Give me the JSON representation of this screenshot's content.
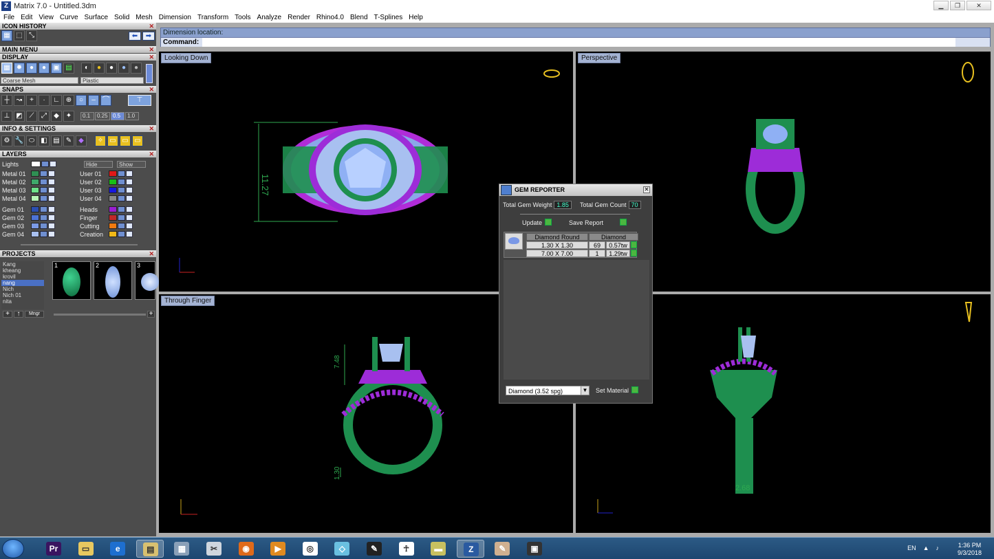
{
  "window": {
    "title": "Matrix 7.0 - Untitled.3dm",
    "app_icon": "Z"
  },
  "menu": [
    "File",
    "Edit",
    "View",
    "Curve",
    "Surface",
    "Solid",
    "Mesh",
    "Dimension",
    "Transform",
    "Tools",
    "Analyze",
    "Render",
    "Rhino4.0",
    "Blend",
    "T-Splines",
    "Help"
  ],
  "panels": {
    "icon_history": "ICON HISTORY",
    "main_menu": "MAIN MENU",
    "display": "DISPLAY",
    "display_mesh": "Coarse Mesh",
    "display_material": "Plastic",
    "snaps": "SNAPS",
    "snap_values": [
      "0.1",
      "0.25",
      "0.5",
      "1.0"
    ],
    "info": "INFO & SETTINGS",
    "layers": "LAYERS",
    "projects": "PROJECTS"
  },
  "layers": {
    "lights": "Lights",
    "hide": "Hide",
    "show": "Show",
    "left": [
      {
        "name": "Metal 01",
        "color": "#2f8f53"
      },
      {
        "name": "Metal 02",
        "color": "#3fa86a"
      },
      {
        "name": "Metal 03",
        "color": "#6ee28a"
      },
      {
        "name": "Metal 04",
        "color": "#b8f5b5"
      },
      {
        "name": "Gem 01",
        "color": "#2c4fb0"
      },
      {
        "name": "Gem 02",
        "color": "#4d73d6"
      },
      {
        "name": "Gem 03",
        "color": "#7b9ae6"
      },
      {
        "name": "Gem 04",
        "color": "#a8c0f0"
      }
    ],
    "right": [
      {
        "name": "User 01",
        "color": "#e01818"
      },
      {
        "name": "User 02",
        "color": "#18c018"
      },
      {
        "name": "User 03",
        "color": "#1818e0"
      },
      {
        "name": "User 04",
        "color": "#8a8a8a"
      },
      {
        "name": "Heads",
        "color": "#9a1ed0"
      },
      {
        "name": "Finger",
        "color": "#c02828"
      },
      {
        "name": "Cutting",
        "color": "#f07a10"
      },
      {
        "name": "Creation",
        "color": "#f0b818"
      }
    ]
  },
  "projects": {
    "items": [
      "Kang",
      "kheang",
      "krovil",
      "nang",
      "Nich",
      "Nich 01",
      "nita"
    ],
    "selected": "nang",
    "thumb_numbers": [
      "1",
      "2",
      "3"
    ],
    "manager_label": "Mngr"
  },
  "command": {
    "line1": "Dimension location:",
    "line2": "Command:"
  },
  "viewports": {
    "top_left": "Looking Down",
    "top_right": "Perspective",
    "bottom_left": "Through Finger",
    "dims": {
      "top_height": "11.27",
      "finger_top": "7.48",
      "finger_bottom": "1.30",
      "side_width": "2.68"
    }
  },
  "gem_reporter": {
    "title": "GEM REPORTER",
    "total_weight_label": "Total Gem Weight",
    "total_weight": "1.85",
    "total_count_label": "Total Gem Count",
    "total_count": "70",
    "update": "Update",
    "save_report": "Save Report",
    "col_shape": "Diamond Round",
    "col_material": "Diamond",
    "rows": [
      {
        "size": "1.30 X 1.30",
        "count": "69",
        "weight": "0.57tw"
      },
      {
        "size": "7.00 X 7.00",
        "count": "1",
        "weight": "1.29tw"
      }
    ],
    "material_select": "Diamond     (3.52 spg)",
    "set_material": "Set Material"
  },
  "taskbar": {
    "lang": "EN",
    "time": "1:36 PM",
    "date": "9/3/2018",
    "apps": [
      "premiere",
      "explorer-folder",
      "ie",
      "file-manager",
      "calculator",
      "scissors",
      "firefox",
      "media",
      "chrome",
      "notes",
      "pen",
      "zbrush",
      "sticky",
      "matrix",
      "paint",
      "app"
    ]
  },
  "colors": {
    "metal": "#1e8f4f",
    "gem": "#8ab4f0",
    "heads": "#9d2cd8",
    "dim_line": "#2faa50",
    "axis_x": "#c22",
    "axis_y": "#22c",
    "axis_z": "#c9a21a"
  }
}
